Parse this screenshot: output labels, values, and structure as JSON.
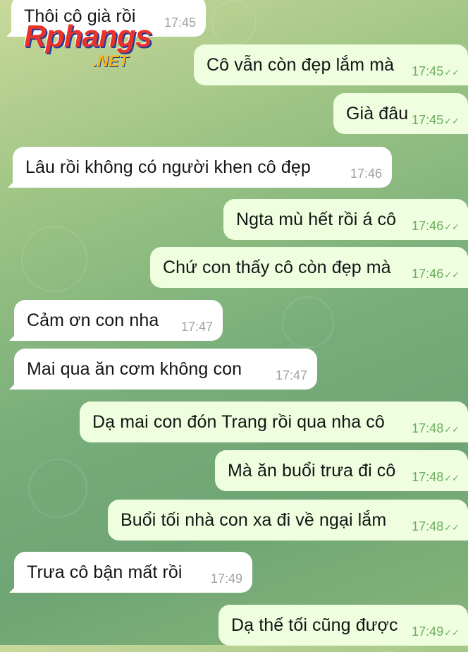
{
  "watermark": {
    "main": "Rphangs",
    "sub": ".NET"
  },
  "colors": {
    "incoming": "#ffffff",
    "outgoing": "#eefedf",
    "time_out": "#6bae5f",
    "time_in": "#a2a2a2"
  },
  "messages": [
    {
      "text": "Thôi cô già rồi",
      "time": "17:45",
      "dir": "in"
    },
    {
      "text": "Cô vẫn còn đẹp lắm mà",
      "time": "17:45",
      "dir": "out"
    },
    {
      "text": "Già đâu",
      "time": "17:45",
      "dir": "out"
    },
    {
      "text": "Lâu rồi không có người khen cô đẹp",
      "time": "17:46",
      "dir": "in"
    },
    {
      "text": "Ngta mù hết rồi á cô",
      "time": "17:46",
      "dir": "out"
    },
    {
      "text": "Chứ con thấy cô còn đẹp mà",
      "time": "17:46",
      "dir": "out"
    },
    {
      "text": "Cảm ơn con nha",
      "time": "17:47",
      "dir": "in"
    },
    {
      "text": "Mai qua ăn cơm không con",
      "time": "17:47",
      "dir": "in"
    },
    {
      "text": "Dạ mai con đón Trang rồi qua nha cô",
      "time": "17:48",
      "dir": "out"
    },
    {
      "text": "Mà ăn buổi trưa đi cô",
      "time": "17:48",
      "dir": "out"
    },
    {
      "text": "Buổi tối nhà con xa đi về ngại lắm",
      "time": "17:48",
      "dir": "out"
    },
    {
      "text": "Trưa cô bận mất rồi",
      "time": "17:49",
      "dir": "in"
    },
    {
      "text": "Dạ thế tối cũng được",
      "time": "17:49",
      "dir": "out"
    }
  ]
}
